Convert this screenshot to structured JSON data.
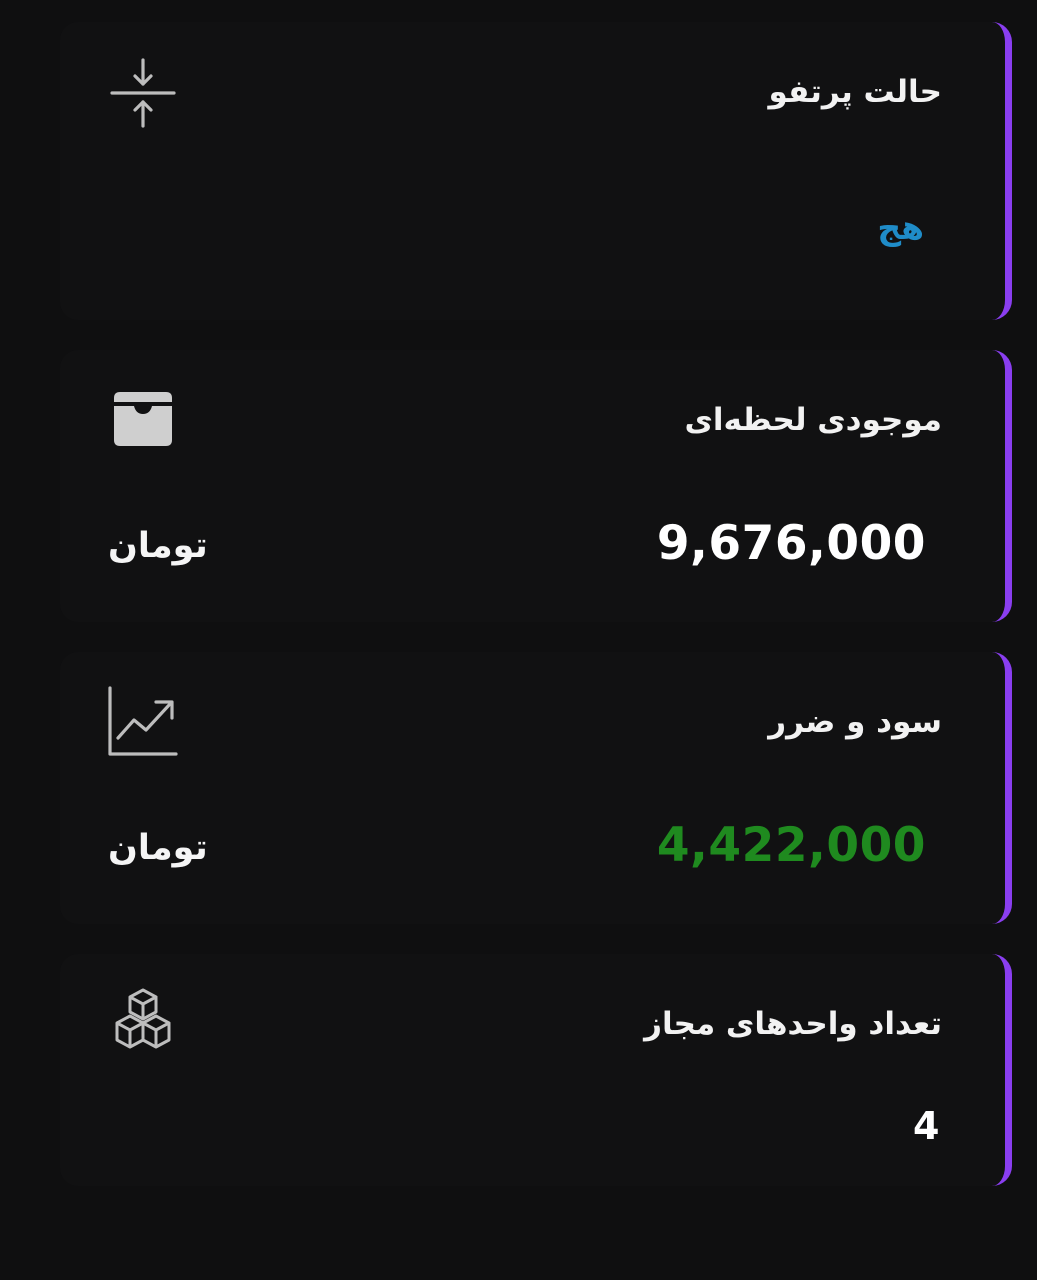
{
  "cards": [
    {
      "title": "حالت پرتفو",
      "value": "هج",
      "icon": "compress-vertical-icon",
      "value_color": "#1f8cc8"
    },
    {
      "title": "موجودی لحظه‌ای",
      "value": "9,676,000",
      "unit": "تومان",
      "icon": "wallet-icon",
      "value_color": "#ffffff"
    },
    {
      "title": "سود و ضرر",
      "value": "4,422,000",
      "unit": "تومان",
      "icon": "trend-chart-icon",
      "value_color": "#1f8a1f"
    },
    {
      "title": "تعداد واحدهای مجاز",
      "value": "4",
      "icon": "cubes-icon",
      "value_color": "#ffffff"
    }
  ],
  "accent_color": "#8a3ef0"
}
